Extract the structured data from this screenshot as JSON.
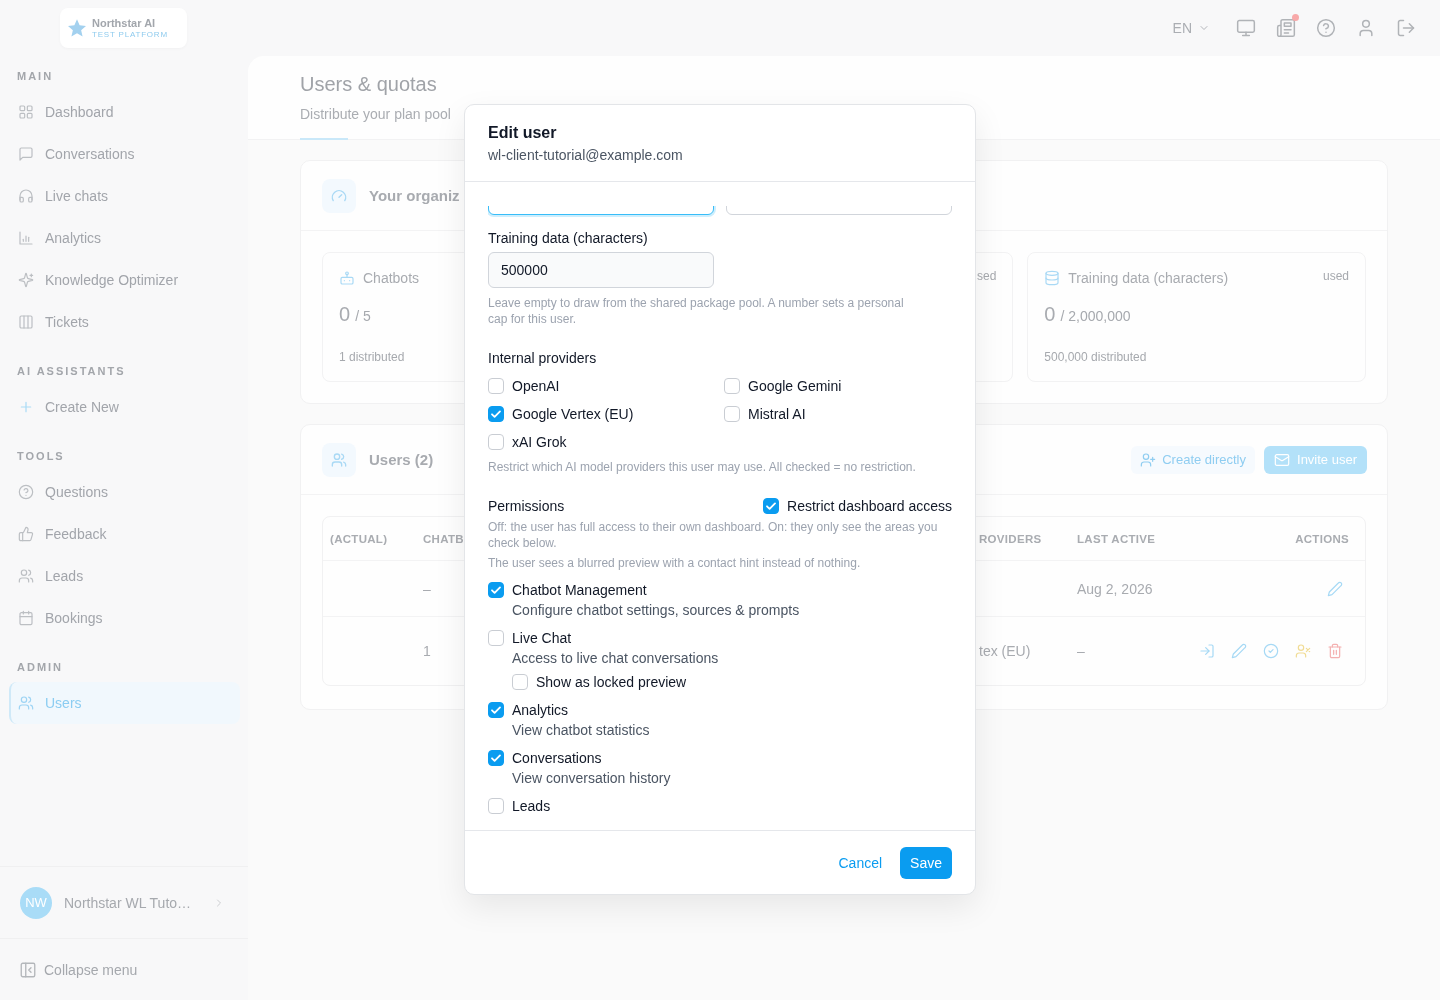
{
  "logo": {
    "name": "Northstar AI",
    "tagline": "TEST PLATFORM"
  },
  "sidebar": {
    "sections": [
      {
        "label": "MAIN",
        "items": [
          {
            "label": "Dashboard",
            "selected": false
          },
          {
            "label": "Conversations",
            "selected": false
          },
          {
            "label": "Live chats",
            "selected": false
          },
          {
            "label": "Analytics",
            "selected": false
          },
          {
            "label": "Knowledge Optimizer",
            "selected": false
          },
          {
            "label": "Tickets",
            "selected": false
          }
        ]
      },
      {
        "label": "AI ASSISTANTS",
        "items": [
          {
            "label": "Create New",
            "selected": false
          }
        ]
      },
      {
        "label": "TOOLS",
        "items": [
          {
            "label": "Questions",
            "selected": false
          },
          {
            "label": "Feedback",
            "selected": false
          },
          {
            "label": "Leads",
            "selected": false
          },
          {
            "label": "Bookings",
            "selected": false
          }
        ]
      },
      {
        "label": "ADMIN",
        "items": [
          {
            "label": "Users",
            "selected": true
          }
        ]
      }
    ],
    "account": {
      "initials": "NW",
      "name": "Northstar WL Tuto…"
    },
    "collapse_label": "Collapse menu"
  },
  "topbar": {
    "language": "EN",
    "news_unread": true
  },
  "page_header": {
    "title": "Users & quotas",
    "subtitle": "Distribute your plan pool"
  },
  "organization_card": {
    "title": "Your organiz",
    "stats": [
      {
        "title": "Chatbots",
        "value": "0",
        "limit": "/ 5",
        "note": "1 distributed"
      },
      {
        "used": "sed"
      },
      {
        "title": "Training data (characters)",
        "used": "used",
        "value": "0",
        "limit": "/ 2,000,000",
        "note": "500,000 distributed"
      }
    ]
  },
  "users_card": {
    "title": "Users (2)",
    "buttons": [
      {
        "label": "Create directly",
        "kind": "secondary"
      },
      {
        "label": "Invite user",
        "kind": "primary"
      }
    ],
    "table": {
      "columns": [
        "(ACTUAL)",
        "CHATB",
        "ROVIDERS",
        "LAST ACTIVE",
        "ACTIONS"
      ],
      "rows": [
        {
          "column_2": "–",
          "last_active": "Aug 2, 2026",
          "actions": [
            {
              "kind": "edit"
            }
          ]
        },
        {
          "column_2": "1",
          "column_3": "tex (EU)",
          "last_active": "–",
          "actions": [
            {
              "kind": "login"
            },
            {
              "kind": "edit"
            },
            {
              "kind": "verify"
            },
            {
              "kind": "remove"
            },
            {
              "kind": "delete"
            }
          ]
        }
      ]
    }
  },
  "modal": {
    "title": "Edit user",
    "email": "wl-client-tutorial@example.com",
    "partial_fields": [
      {
        "focused": true
      },
      {
        "focused": false
      }
    ],
    "training_field": {
      "label": "Training data (characters)",
      "value": "500000",
      "help": "Leave empty to draw from the shared package pool. A number sets a personal cap for this user."
    },
    "providers": {
      "label": "Internal providers",
      "options": [
        {
          "label": "OpenAI",
          "checked": false
        },
        {
          "label": "Google Gemini",
          "checked": false
        },
        {
          "label": "Google Vertex (EU)",
          "checked": true
        },
        {
          "label": "Mistral AI",
          "checked": false
        },
        {
          "label": "xAI Grok",
          "checked": false
        }
      ],
      "help": "Restrict which AI model providers this user may use. All checked = no restriction."
    },
    "permissions": {
      "label": "Permissions",
      "restrict": {
        "label": "Restrict dashboard access",
        "checked": true
      },
      "help": "Off: the user has full access to their own dashboard. On: they only see the areas you check below.",
      "preview_note": "The user sees a blurred preview with a contact hint instead of nothing.",
      "items": [
        {
          "label": "Chatbot Management",
          "description": "Configure chatbot settings, sources & prompts",
          "checked": true
        },
        {
          "label": "Live Chat",
          "description": "Access to live chat conversations",
          "checked": false,
          "locked_preview": {
            "label": "Show as locked preview",
            "checked": false
          }
        },
        {
          "label": "Analytics",
          "description": "View chatbot statistics",
          "checked": true
        },
        {
          "label": "Conversations",
          "description": "View conversation history",
          "checked": true
        },
        {
          "label": "Leads",
          "checked": false
        }
      ]
    },
    "buttons": [
      {
        "label": "Cancel",
        "kind": "text"
      },
      {
        "label": "Save",
        "kind": "primary"
      }
    ]
  }
}
